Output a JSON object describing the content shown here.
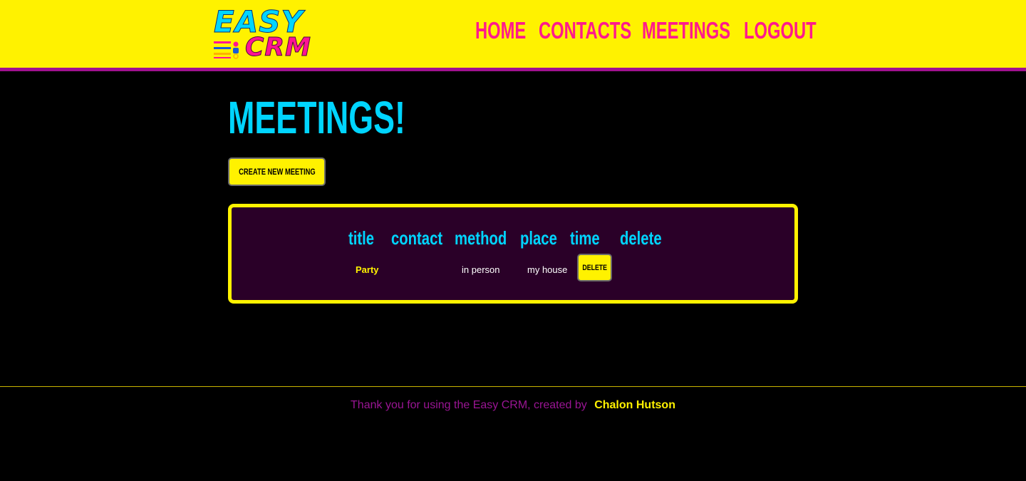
{
  "header": {
    "logo": {
      "line1": "EASY",
      "line2": "CRM",
      "icon": "contact-list-icon"
    },
    "nav": [
      {
        "label": "HOME"
      },
      {
        "label": "CONTACTS"
      },
      {
        "label": "MEETINGS"
      },
      {
        "label": "LOGOUT"
      }
    ]
  },
  "main": {
    "title": "MEETINGS!",
    "create_button": "CREATE NEW MEETING",
    "table": {
      "columns": [
        "title",
        "contact",
        "method",
        "place",
        "time",
        "delete"
      ],
      "rows": [
        {
          "title": "Party",
          "contact": "",
          "method": "in person",
          "place": "my house",
          "time": "",
          "delete_label": "DELETE"
        }
      ]
    }
  },
  "footer": {
    "thanks": "Thank you for using the Easy CRM, created by",
    "author": "Chalon Hutson"
  },
  "colors": {
    "header_bg": "#fff200",
    "header_border": "#a0118f",
    "nav": "#ff1a8c",
    "accent_cyan": "#00d5ff",
    "table_bg": "#2a0028",
    "footer_thanks": "#9a1594",
    "footer_author": "#fff200"
  }
}
